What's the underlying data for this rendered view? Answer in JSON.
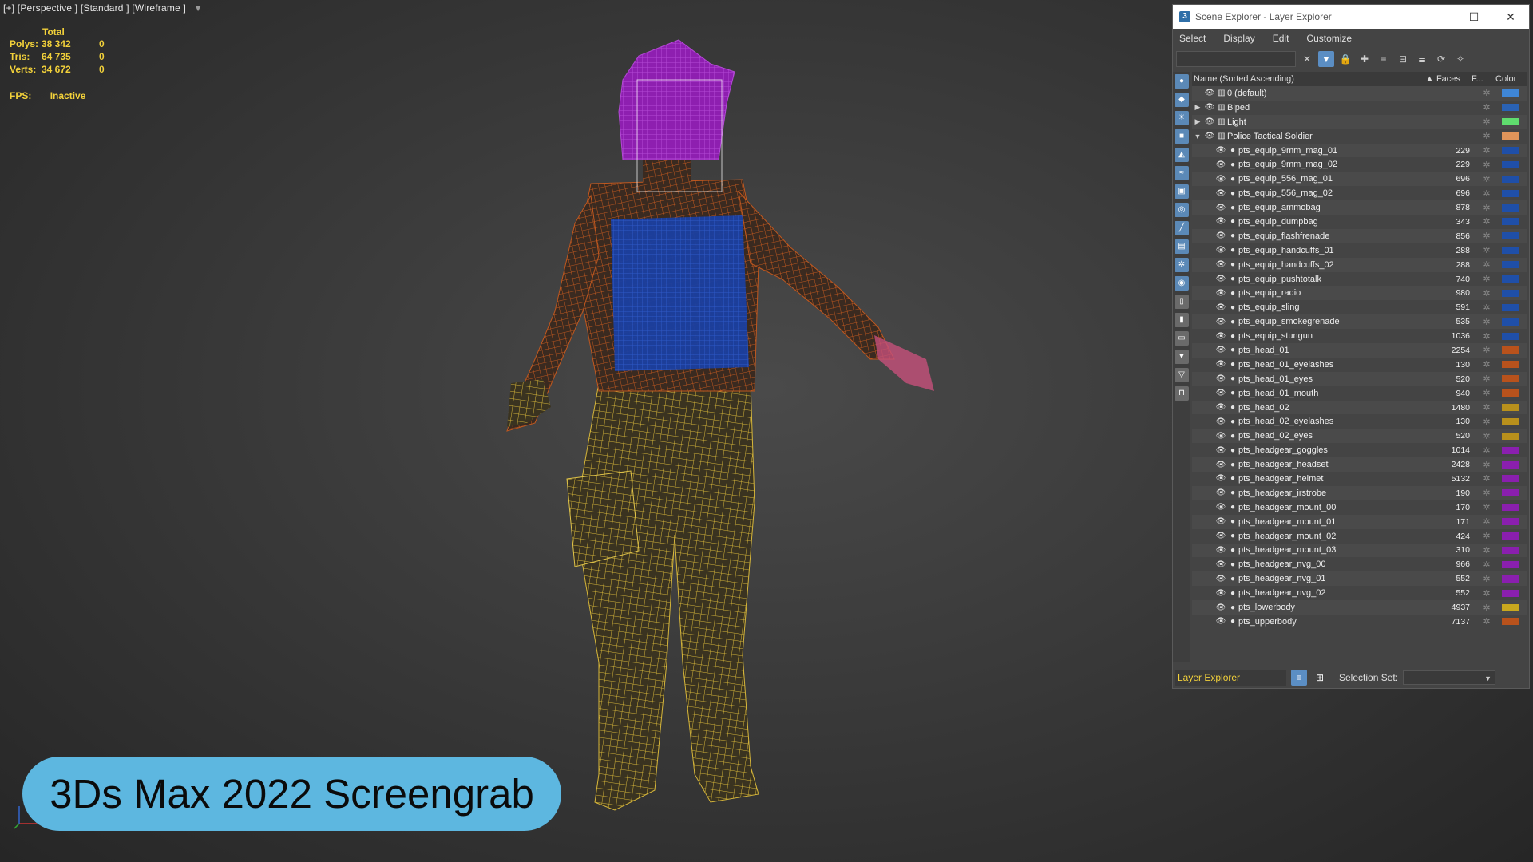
{
  "viewport": {
    "label": "[+] [Perspective ] [Standard ] [Wireframe ]",
    "stats": {
      "header": "Total",
      "rows": [
        {
          "key": "Polys:",
          "value": "38 342",
          "extra": "0"
        },
        {
          "key": "Tris:",
          "value": "64 735",
          "extra": "0"
        },
        {
          "key": "Verts:",
          "value": "34 672",
          "extra": "0"
        }
      ],
      "fps_key": "FPS:",
      "fps_value": "Inactive"
    }
  },
  "badge": "3Ds Max 2022 Screengrab",
  "explorer": {
    "title": "Scene Explorer - Layer Explorer",
    "menu": [
      "Select",
      "Display",
      "Edit",
      "Customize"
    ],
    "columns": {
      "name": "Name (Sorted Ascending)",
      "faces": "Faces",
      "frozen": "F...",
      "color": "Color"
    },
    "rows": [
      {
        "level": 0,
        "expander": "",
        "name": "0 (default)",
        "faces": "",
        "color": "#3f86d6"
      },
      {
        "level": 0,
        "expander": "▶",
        "name": "Biped",
        "faces": "",
        "color": "#2a62b4"
      },
      {
        "level": 0,
        "expander": "▶",
        "name": "Light",
        "faces": "",
        "color": "#5fdc6e"
      },
      {
        "level": 0,
        "expander": "▼",
        "name": "Police Tactical Soldier",
        "faces": "",
        "color": "#e0945a"
      },
      {
        "level": 1,
        "expander": "",
        "name": "pts_equip_9mm_mag_01",
        "faces": "229",
        "color": "#1f4fa8"
      },
      {
        "level": 1,
        "expander": "",
        "name": "pts_equip_9mm_mag_02",
        "faces": "229",
        "color": "#1f4fa8"
      },
      {
        "level": 1,
        "expander": "",
        "name": "pts_equip_556_mag_01",
        "faces": "696",
        "color": "#1f4fa8"
      },
      {
        "level": 1,
        "expander": "",
        "name": "pts_equip_556_mag_02",
        "faces": "696",
        "color": "#1f4fa8"
      },
      {
        "level": 1,
        "expander": "",
        "name": "pts_equip_ammobag",
        "faces": "878",
        "color": "#1f4fa8"
      },
      {
        "level": 1,
        "expander": "",
        "name": "pts_equip_dumpbag",
        "faces": "343",
        "color": "#1f4fa8"
      },
      {
        "level": 1,
        "expander": "",
        "name": "pts_equip_flashfrenade",
        "faces": "856",
        "color": "#1f4fa8"
      },
      {
        "level": 1,
        "expander": "",
        "name": "pts_equip_handcuffs_01",
        "faces": "288",
        "color": "#1f4fa8"
      },
      {
        "level": 1,
        "expander": "",
        "name": "pts_equip_handcuffs_02",
        "faces": "288",
        "color": "#1f4fa8"
      },
      {
        "level": 1,
        "expander": "",
        "name": "pts_equip_pushtotalk",
        "faces": "740",
        "color": "#1f4fa8"
      },
      {
        "level": 1,
        "expander": "",
        "name": "pts_equip_radio",
        "faces": "980",
        "color": "#1f4fa8"
      },
      {
        "level": 1,
        "expander": "",
        "name": "pts_equip_sling",
        "faces": "591",
        "color": "#1f4fa8"
      },
      {
        "level": 1,
        "expander": "",
        "name": "pts_equip_smokegrenade",
        "faces": "535",
        "color": "#1f4fa8"
      },
      {
        "level": 1,
        "expander": "",
        "name": "pts_equip_stungun",
        "faces": "1036",
        "color": "#1f4fa8"
      },
      {
        "level": 1,
        "expander": "",
        "name": "pts_head_01",
        "faces": "2254",
        "color": "#b8521c"
      },
      {
        "level": 1,
        "expander": "",
        "name": "pts_head_01_eyelashes",
        "faces": "130",
        "color": "#b8521c"
      },
      {
        "level": 1,
        "expander": "",
        "name": "pts_head_01_eyes",
        "faces": "520",
        "color": "#b8521c"
      },
      {
        "level": 1,
        "expander": "",
        "name": "pts_head_01_mouth",
        "faces": "940",
        "color": "#b8521c"
      },
      {
        "level": 1,
        "expander": "",
        "name": "pts_head_02",
        "faces": "1480",
        "color": "#b8901c"
      },
      {
        "level": 1,
        "expander": "",
        "name": "pts_head_02_eyelashes",
        "faces": "130",
        "color": "#b8901c"
      },
      {
        "level": 1,
        "expander": "",
        "name": "pts_head_02_eyes",
        "faces": "520",
        "color": "#b8901c"
      },
      {
        "level": 1,
        "expander": "",
        "name": "pts_headgear_goggles",
        "faces": "1014",
        "color": "#8a1fae"
      },
      {
        "level": 1,
        "expander": "",
        "name": "pts_headgear_headset",
        "faces": "2428",
        "color": "#8a1fae"
      },
      {
        "level": 1,
        "expander": "",
        "name": "pts_headgear_helmet",
        "faces": "5132",
        "color": "#8a1fae"
      },
      {
        "level": 1,
        "expander": "",
        "name": "pts_headgear_irstrobe",
        "faces": "190",
        "color": "#8a1fae"
      },
      {
        "level": 1,
        "expander": "",
        "name": "pts_headgear_mount_00",
        "faces": "170",
        "color": "#8a1fae"
      },
      {
        "level": 1,
        "expander": "",
        "name": "pts_headgear_mount_01",
        "faces": "171",
        "color": "#8a1fae"
      },
      {
        "level": 1,
        "expander": "",
        "name": "pts_headgear_mount_02",
        "faces": "424",
        "color": "#8a1fae"
      },
      {
        "level": 1,
        "expander": "",
        "name": "pts_headgear_mount_03",
        "faces": "310",
        "color": "#8a1fae"
      },
      {
        "level": 1,
        "expander": "",
        "name": "pts_headgear_nvg_00",
        "faces": "966",
        "color": "#8a1fae"
      },
      {
        "level": 1,
        "expander": "",
        "name": "pts_headgear_nvg_01",
        "faces": "552",
        "color": "#8a1fae"
      },
      {
        "level": 1,
        "expander": "",
        "name": "pts_headgear_nvg_02",
        "faces": "552",
        "color": "#8a1fae"
      },
      {
        "level": 1,
        "expander": "",
        "name": "pts_lowerbody",
        "faces": "4937",
        "color": "#c9a81e"
      },
      {
        "level": 1,
        "expander": "",
        "name": "pts_upperbody",
        "faces": "7137",
        "color": "#b8521c"
      }
    ],
    "bottom": {
      "explorer_name": "Layer Explorer",
      "selection_label": "Selection Set:"
    }
  }
}
